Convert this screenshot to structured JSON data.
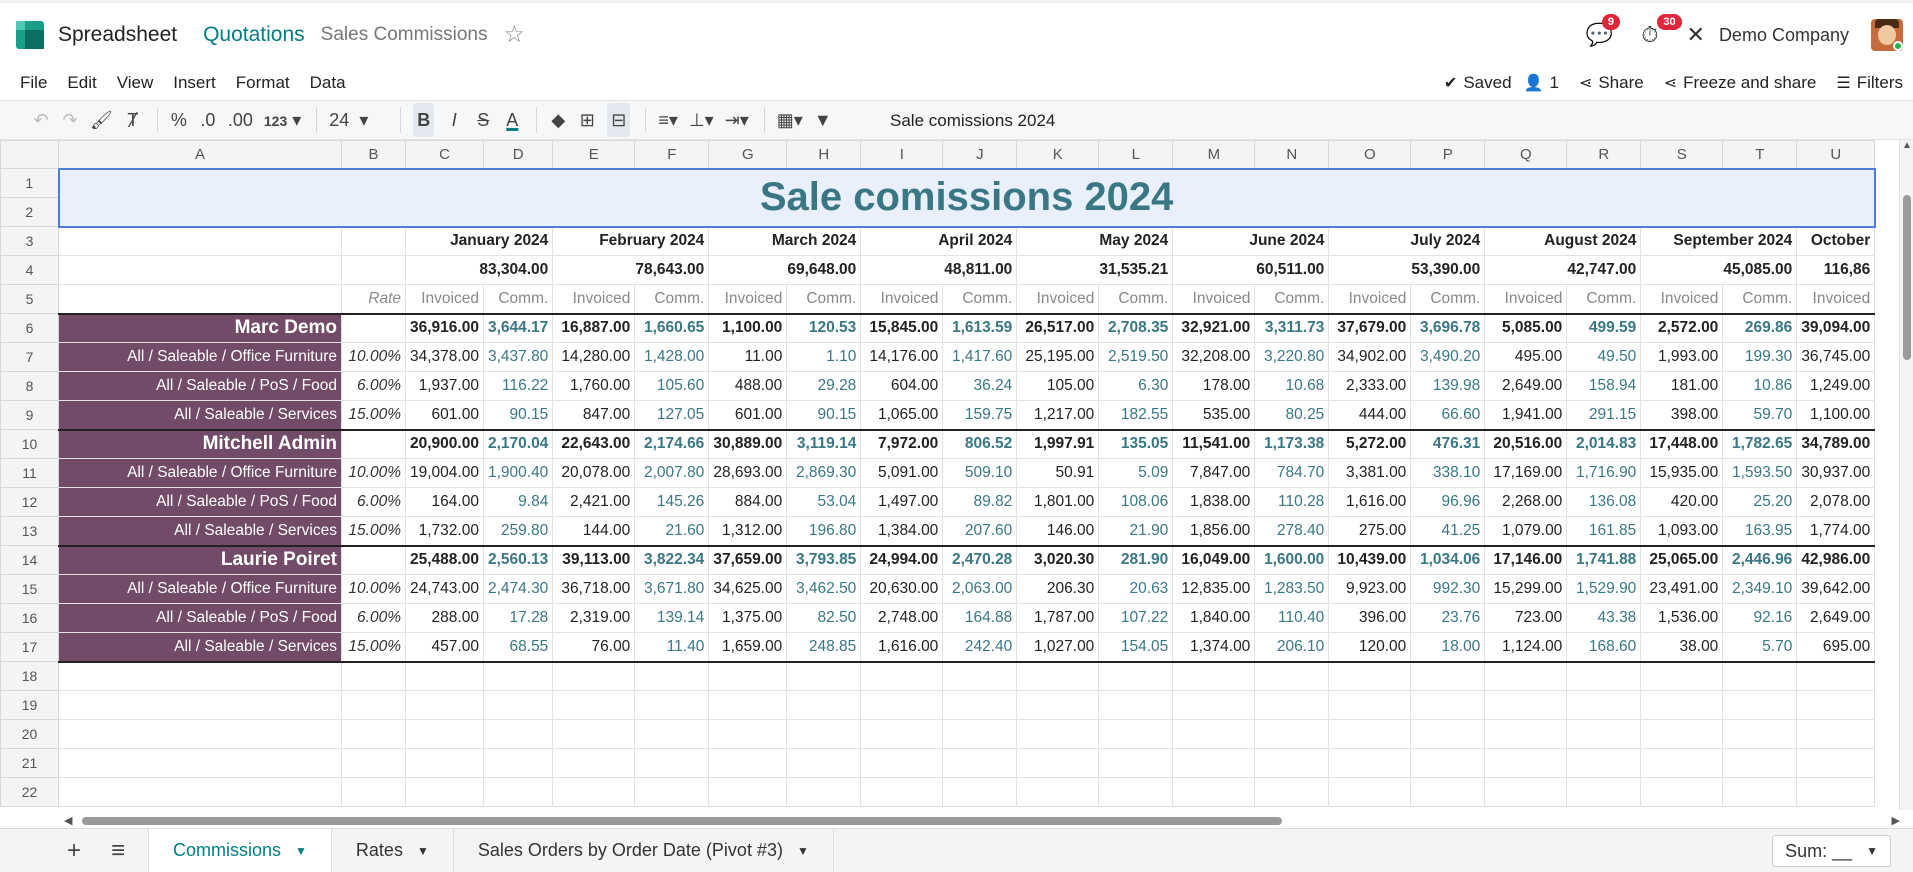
{
  "header": {
    "app_name": "Spreadsheet",
    "breadcrumb_parent": "Quotations",
    "breadcrumb_current": "Sales Commissions",
    "messages_count": "9",
    "activities_count": "30",
    "company": "Demo Company"
  },
  "menu": {
    "file": "File",
    "edit": "Edit",
    "view": "View",
    "insert": "Insert",
    "format": "Format",
    "data": "Data",
    "saved": "Saved",
    "users": "1",
    "share": "Share",
    "freeze_share": "Freeze and share",
    "filters": "Filters"
  },
  "toolbar": {
    "percent": "%",
    "dec_less": ".0",
    "dec_more": ".00",
    "number_format": "123",
    "font_size": "24",
    "bold": "B",
    "italic": "I",
    "strike": "S",
    "text_color": "A",
    "formula": "Sale comissions 2024"
  },
  "sheet": {
    "columns": [
      "A",
      "B",
      "C",
      "D",
      "E",
      "F",
      "G",
      "H",
      "I",
      "J",
      "K",
      "L",
      "M",
      "N",
      "O",
      "P",
      "Q",
      "R",
      "S",
      "T",
      "U"
    ],
    "row_numbers": [
      "1",
      "2",
      "3",
      "4",
      "5",
      "6",
      "7",
      "8",
      "9",
      "10",
      "11",
      "12",
      "13",
      "14",
      "15",
      "16",
      "17",
      "18",
      "19",
      "20",
      "21",
      "22"
    ],
    "title": "Sale comissions 2024",
    "months": [
      "January 2024",
      "February 2024",
      "March 2024",
      "April 2024",
      "May 2024",
      "June 2024",
      "July 2024",
      "August 2024",
      "September 2024",
      "October"
    ],
    "month_totals": [
      "83,304.00",
      "78,643.00",
      "69,648.00",
      "48,811.00",
      "31,535.21",
      "60,511.00",
      "53,390.00",
      "42,747.00",
      "45,085.00",
      "116,86"
    ],
    "rate_header": "Rate",
    "invoiced_header": "Invoiced",
    "comm_header": "Comm.",
    "groups": [
      {
        "name": "Marc Demo",
        "values": [
          "36,916.00",
          "3,644.17",
          "16,887.00",
          "1,660.65",
          "1,100.00",
          "120.53",
          "15,845.00",
          "1,613.59",
          "26,517.00",
          "2,708.35",
          "32,921.00",
          "3,311.73",
          "37,679.00",
          "3,696.78",
          "5,085.00",
          "499.59",
          "2,572.00",
          "269.86",
          "39,094.00"
        ],
        "lines": [
          {
            "name": "All / Saleable / Office Furniture",
            "rate": "10.00%",
            "values": [
              "34,378.00",
              "3,437.80",
              "14,280.00",
              "1,428.00",
              "11.00",
              "1.10",
              "14,176.00",
              "1,417.60",
              "25,195.00",
              "2,519.50",
              "32,208.00",
              "3,220.80",
              "34,902.00",
              "3,490.20",
              "495.00",
              "49.50",
              "1,993.00",
              "199.30",
              "36,745.00"
            ]
          },
          {
            "name": "All / Saleable / PoS / Food",
            "rate": "6.00%",
            "values": [
              "1,937.00",
              "116.22",
              "1,760.00",
              "105.60",
              "488.00",
              "29.28",
              "604.00",
              "36.24",
              "105.00",
              "6.30",
              "178.00",
              "10.68",
              "2,333.00",
              "139.98",
              "2,649.00",
              "158.94",
              "181.00",
              "10.86",
              "1,249.00"
            ]
          },
          {
            "name": "All / Saleable / Services",
            "rate": "15.00%",
            "values": [
              "601.00",
              "90.15",
              "847.00",
              "127.05",
              "601.00",
              "90.15",
              "1,065.00",
              "159.75",
              "1,217.00",
              "182.55",
              "535.00",
              "80.25",
              "444.00",
              "66.60",
              "1,941.00",
              "291.15",
              "398.00",
              "59.70",
              "1,100.00"
            ]
          }
        ]
      },
      {
        "name": "Mitchell Admin",
        "values": [
          "20,900.00",
          "2,170.04",
          "22,643.00",
          "2,174.66",
          "30,889.00",
          "3,119.14",
          "7,972.00",
          "806.52",
          "1,997.91",
          "135.05",
          "11,541.00",
          "1,173.38",
          "5,272.00",
          "476.31",
          "20,516.00",
          "2,014.83",
          "17,448.00",
          "1,782.65",
          "34,789.00"
        ],
        "lines": [
          {
            "name": "All / Saleable / Office Furniture",
            "rate": "10.00%",
            "values": [
              "19,004.00",
              "1,900.40",
              "20,078.00",
              "2,007.80",
              "28,693.00",
              "2,869.30",
              "5,091.00",
              "509.10",
              "50.91",
              "5.09",
              "7,847.00",
              "784.70",
              "3,381.00",
              "338.10",
              "17,169.00",
              "1,716.90",
              "15,935.00",
              "1,593.50",
              "30,937.00"
            ]
          },
          {
            "name": "All / Saleable / PoS / Food",
            "rate": "6.00%",
            "values": [
              "164.00",
              "9.84",
              "2,421.00",
              "145.26",
              "884.00",
              "53.04",
              "1,497.00",
              "89.82",
              "1,801.00",
              "108.06",
              "1,838.00",
              "110.28",
              "1,616.00",
              "96.96",
              "2,268.00",
              "136.08",
              "420.00",
              "25.20",
              "2,078.00"
            ]
          },
          {
            "name": "All / Saleable / Services",
            "rate": "15.00%",
            "values": [
              "1,732.00",
              "259.80",
              "144.00",
              "21.60",
              "1,312.00",
              "196.80",
              "1,384.00",
              "207.60",
              "146.00",
              "21.90",
              "1,856.00",
              "278.40",
              "275.00",
              "41.25",
              "1,079.00",
              "161.85",
              "1,093.00",
              "163.95",
              "1,774.00"
            ]
          }
        ]
      },
      {
        "name": "Laurie Poiret",
        "values": [
          "25,488.00",
          "2,560.13",
          "39,113.00",
          "3,822.34",
          "37,659.00",
          "3,793.85",
          "24,994.00",
          "2,470.28",
          "3,020.30",
          "281.90",
          "16,049.00",
          "1,600.00",
          "10,439.00",
          "1,034.06",
          "17,146.00",
          "1,741.88",
          "25,065.00",
          "2,446.96",
          "42,986.00"
        ],
        "lines": [
          {
            "name": "All / Saleable / Office Furniture",
            "rate": "10.00%",
            "values": [
              "24,743.00",
              "2,474.30",
              "36,718.00",
              "3,671.80",
              "34,625.00",
              "3,462.50",
              "20,630.00",
              "2,063.00",
              "206.30",
              "20.63",
              "12,835.00",
              "1,283.50",
              "9,923.00",
              "992.30",
              "15,299.00",
              "1,529.90",
              "23,491.00",
              "2,349.10",
              "39,642.00"
            ]
          },
          {
            "name": "All / Saleable / PoS / Food",
            "rate": "6.00%",
            "values": [
              "288.00",
              "17.28",
              "2,319.00",
              "139.14",
              "1,375.00",
              "82.50",
              "2,748.00",
              "164.88",
              "1,787.00",
              "107.22",
              "1,840.00",
              "110.40",
              "396.00",
              "23.76",
              "723.00",
              "43.38",
              "1,536.00",
              "92.16",
              "2,649.00"
            ]
          },
          {
            "name": "All / Saleable / Services",
            "rate": "15.00%",
            "values": [
              "457.00",
              "68.55",
              "76.00",
              "11.40",
              "1,659.00",
              "248.85",
              "1,616.00",
              "242.40",
              "1,027.00",
              "154.05",
              "1,374.00",
              "206.10",
              "120.00",
              "18.00",
              "1,124.00",
              "168.60",
              "38.00",
              "5.70",
              "695.00"
            ]
          }
        ]
      }
    ]
  },
  "tabs": [
    {
      "label": "Commissions"
    },
    {
      "label": "Rates"
    },
    {
      "label": "Sales Orders by Order Date (Pivot #3)"
    }
  ],
  "status": {
    "sum": "Sum: __"
  }
}
